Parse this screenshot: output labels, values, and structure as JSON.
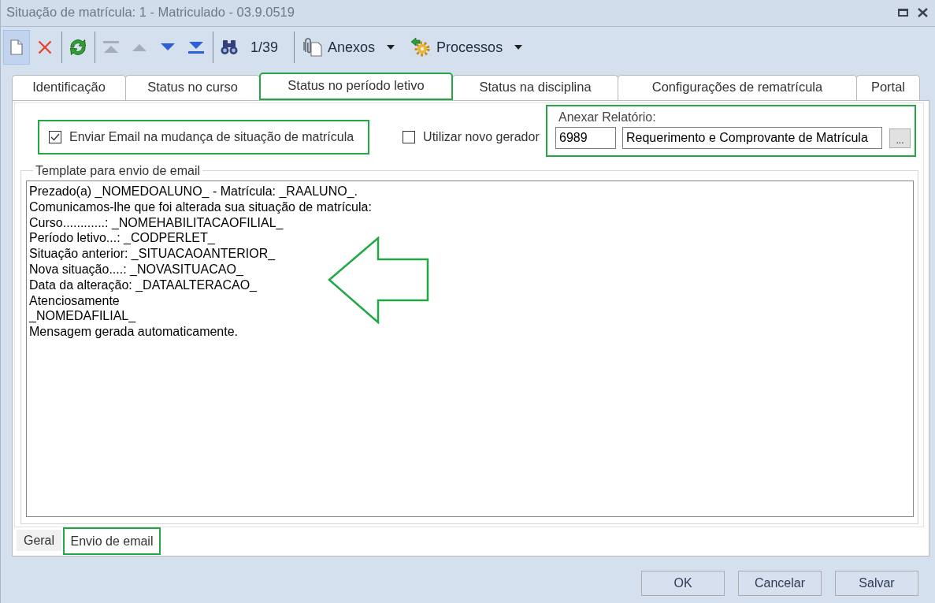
{
  "window": {
    "title": "Situação de matrícula: 1 - Matriculado - 03.9.0519"
  },
  "toolbar": {
    "button_groups": [
      [
        {
          "kind": "new",
          "disabled": false,
          "highlighted": true
        },
        {
          "kind": "delete",
          "disabled": false,
          "highlighted": false
        }
      ],
      [
        {
          "kind": "refresh",
          "disabled": false,
          "highlighted": false
        }
      ],
      [
        {
          "kind": "first",
          "disabled": true,
          "highlighted": false
        },
        {
          "kind": "previous",
          "disabled": true,
          "highlighted": false
        },
        {
          "kind": "next",
          "disabled": false,
          "highlighted": false
        },
        {
          "kind": "last",
          "disabled": false,
          "highlighted": false
        }
      ],
      [
        {
          "kind": "find",
          "disabled": false,
          "highlighted": false
        }
      ]
    ],
    "record_counter": "1/39",
    "menus": [
      {
        "kind": "attachments",
        "label": "Anexos"
      },
      {
        "kind": "processes",
        "label": "Processos"
      }
    ]
  },
  "tabs": [
    {
      "label": "Identificação",
      "selected": false,
      "marked": false
    },
    {
      "label": "Status no curso",
      "selected": false,
      "marked": false
    },
    {
      "label": "Status no período letivo",
      "selected": true,
      "marked": true
    },
    {
      "label": "Status na disciplina",
      "selected": false,
      "marked": false
    },
    {
      "label": "Configurações de rematrícula",
      "selected": false,
      "marked": false
    },
    {
      "label": "Portal",
      "selected": false,
      "marked": false
    }
  ],
  "checkboxes": [
    {
      "label": "Enviar Email na mudança de situação de matrícula",
      "checked": true,
      "marked": true
    },
    {
      "label": "Utilizar novo gerador",
      "checked": false,
      "marked": false
    }
  ],
  "attach_report": {
    "label": "Anexar Relatório:",
    "code": "6989",
    "name": "Requerimento e Comprovante de Matrícula",
    "browse_label": "...",
    "marked": true
  },
  "template": {
    "label": "Template para envio de email",
    "lines": [
      "Prezado(a) _NOMEDOALUNO_ - Matrícula: _RAALUNO_.",
      "Comunicamos-lhe que foi alterada sua situação de matrícula:",
      "Curso............: _NOMEHABILITACAOFILIAL_",
      "Período letivo...: _CODPERLET_",
      "Situação anterior: _SITUACAOANTERIOR_",
      "Nova situação....: _NOVASITUACAO_",
      "Data da alteração: _DATAALTERACAO_",
      "Atenciosamente",
      "_NOMEDAFILIAL_",
      "Mensagem gerada automaticamente."
    ]
  },
  "annotations": [
    {
      "kind": "arrow"
    }
  ],
  "bottom_tabs": [
    {
      "label": "Geral",
      "selected": false,
      "marked": false
    },
    {
      "label": "Envio de email",
      "selected": true,
      "marked": true
    }
  ],
  "buttons": [
    {
      "label": "OK"
    },
    {
      "label": "Cancelar"
    },
    {
      "label": "Salvar"
    }
  ]
}
